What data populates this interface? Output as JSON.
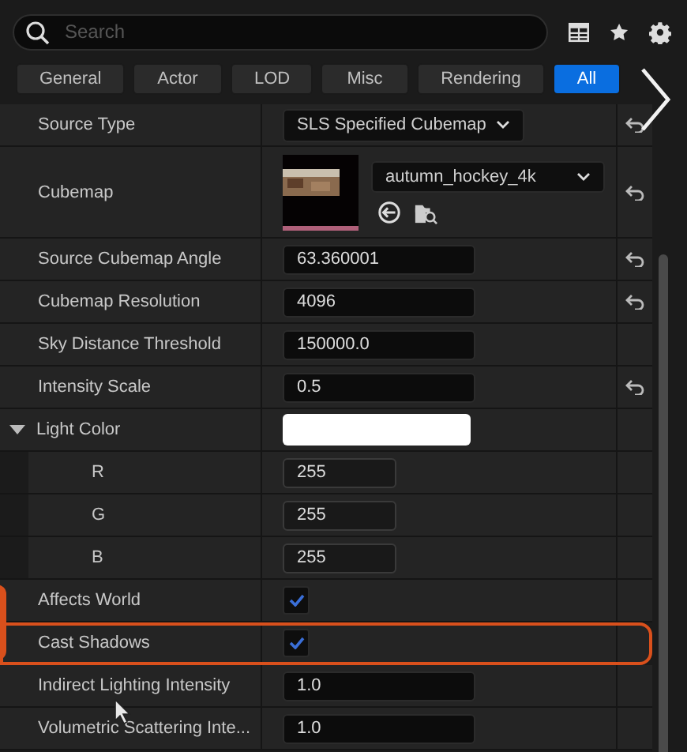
{
  "search": {
    "placeholder": "Search"
  },
  "tabs": [
    {
      "label": "General",
      "selected": false
    },
    {
      "label": "Actor",
      "selected": false
    },
    {
      "label": "LOD",
      "selected": false
    },
    {
      "label": "Misc",
      "selected": false
    },
    {
      "label": "Rendering",
      "selected": false
    },
    {
      "label": "All",
      "selected": true
    }
  ],
  "rows": [
    {
      "kind": "combo",
      "label": "Source Type",
      "value": "SLS Specified Cubemap",
      "reset": true
    },
    {
      "kind": "asset",
      "label": "Cubemap",
      "value": "autumn_hockey_4k",
      "reset": true
    },
    {
      "kind": "number",
      "label": "Source Cubemap Angle",
      "value": "63.360001",
      "reset": true
    },
    {
      "kind": "number",
      "label": "Cubemap Resolution",
      "value": "4096",
      "reset": true
    },
    {
      "kind": "number",
      "label": "Sky Distance Threshold",
      "value": "150000.0"
    },
    {
      "kind": "number",
      "label": "Intensity Scale",
      "value": "0.5",
      "reset": true
    },
    {
      "kind": "color",
      "label": "Light Color",
      "color": "#ffffff",
      "expanded": true,
      "children": [
        {
          "kind": "channel",
          "label": "R",
          "value": "255"
        },
        {
          "kind": "channel",
          "label": "G",
          "value": "255"
        },
        {
          "kind": "channel",
          "label": "B",
          "value": "255"
        }
      ]
    },
    {
      "kind": "checkbox",
      "label": "Affects World",
      "checked": true
    },
    {
      "kind": "checkbox",
      "label": "Cast Shadows",
      "checked": true,
      "highlighted": true
    },
    {
      "kind": "number",
      "label": "Indirect Lighting Intensity",
      "value": "1.0"
    },
    {
      "kind": "number",
      "label": "Volumetric Scattering Inte...",
      "value": "1.0"
    }
  ]
}
